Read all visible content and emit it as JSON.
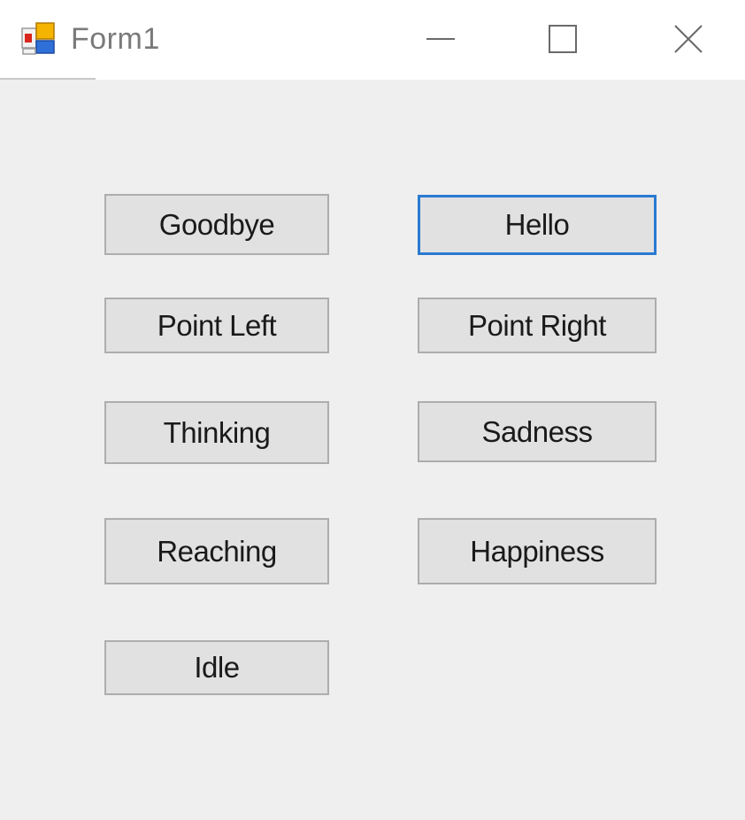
{
  "window": {
    "title": "Form1",
    "icon": "winforms-app-icon",
    "controls": {
      "minimize_icon": "minimize-icon",
      "maximize_icon": "maximize-icon",
      "close_icon": "close-icon"
    }
  },
  "buttons": {
    "goodbye": "Goodbye",
    "hello": "Hello",
    "point_left": "Point Left",
    "point_right": "Point Right",
    "thinking": "Thinking",
    "sadness": "Sadness",
    "reaching": "Reaching",
    "happiness": "Happiness",
    "idle": "Idle"
  },
  "focused_button": "hello",
  "colors": {
    "client_background": "#efefef",
    "button_face": "#e1e1e1",
    "button_border": "#adadad",
    "focus_border": "#2a7ad2",
    "title_text": "#7a7a7a"
  }
}
